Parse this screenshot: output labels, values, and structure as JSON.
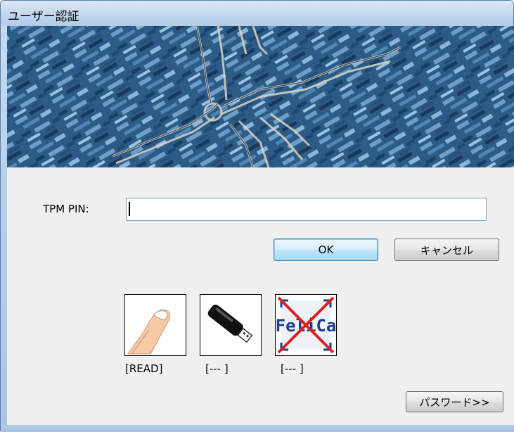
{
  "window": {
    "title": "ユーザー認証"
  },
  "form": {
    "pin_label": "TPM PIN:",
    "pin_value": ""
  },
  "buttons": {
    "ok": "OK",
    "cancel": "キャンセル",
    "password": "パスワード>>"
  },
  "devices": [
    {
      "icon": "finger-icon",
      "status": "[READ]"
    },
    {
      "icon": "usb-key-icon",
      "status": "[--- ]"
    },
    {
      "icon": "felica-disabled-icon",
      "status": "[--- ]",
      "logo_text": "FeliCa"
    }
  ],
  "colors": {
    "ok_border": "#3c7fb1",
    "disabled_cross": "#e01e1e",
    "felica_blue": "#1a3e8c"
  }
}
